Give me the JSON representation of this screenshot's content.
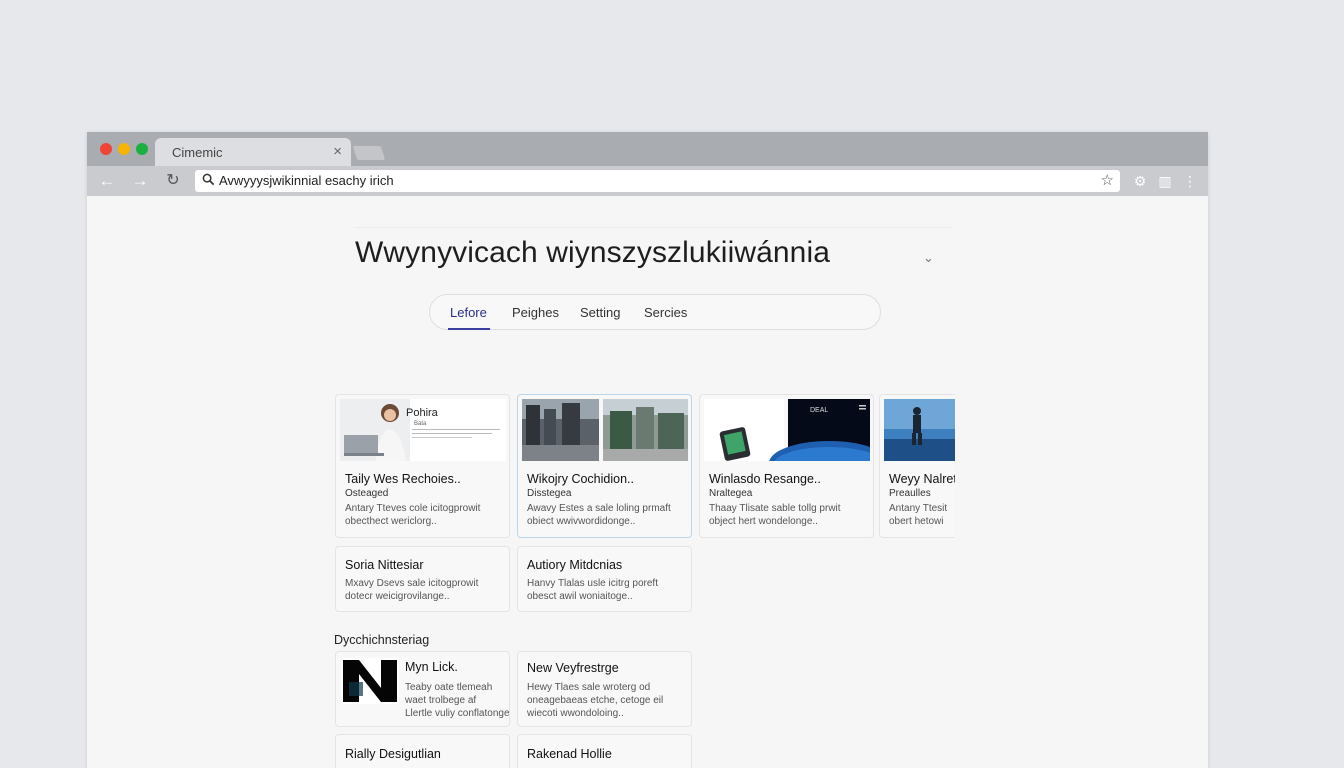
{
  "browser": {
    "tab_title": "Cimemic",
    "tab_close": "×",
    "url": "Avwyyysjwikinnial esachy irich"
  },
  "page": {
    "title": "Wwynyvicach wiynszyszlukiiwánnia",
    "tabs": [
      {
        "label": "Lefore",
        "active": true
      },
      {
        "label": "Peighes",
        "active": false
      },
      {
        "label": "Setting",
        "active": false
      },
      {
        "label": "Sercies",
        "active": false
      }
    ]
  },
  "cards_row1": [
    {
      "title": "Taily Wes Rechoies..",
      "subtitle": "Osteaged",
      "desc": "Antary Tteves cole icitogprowit\nobecthect wericlorg..",
      "thumb_caption": "Pohira",
      "thumb_caption_small": "Bata"
    },
    {
      "title": "Wikojry Cochidion..",
      "subtitle": "Disstegea",
      "desc": "Awavy Estes a sale loling prmaft\nobiect wwivwordidonge..",
      "selected": true
    },
    {
      "title": "Winlasdo Resange..",
      "subtitle": "Nraltegea",
      "desc": "Thaay Tlisate sable tollg prwit\nobject hert wondelonge..",
      "thumb_caption": "DEAL"
    },
    {
      "title": "Weyy Nalret",
      "subtitle": "Preaulles",
      "desc": "Antany Ttesit\nobert hetowi"
    }
  ],
  "cards_row2": [
    {
      "title": "Soria Nittesiar",
      "desc": "Mxavy Dsevs sale icitogprowit\ndotecr weicigrovilange.."
    },
    {
      "title": "Autiory Mitdcnias",
      "desc": "Hanvy Tlalas usle icitrg poreft\nobesct awil woniaitoge.."
    }
  ],
  "section_heading": "Dycchichnsteriag",
  "cards_row3": [
    {
      "title": "Myn Lick.",
      "desc": "Teaby oate tlemeah\nwaet trolbege af\nLlertle vuliy conflatonge.."
    },
    {
      "title": "New Veyfrestrge",
      "desc": "Hewy Tlaes sale wroterg od\noneagebaeas etche, cetoge eil\nwiecoti wwondoloing.."
    }
  ],
  "cards_row4": [
    {
      "title": "Rially Desigutlian"
    },
    {
      "title": "Rakenad Hollie"
    }
  ],
  "colors": {
    "accent": "#3a3fa0",
    "close": "#ef4436",
    "minimize": "#f4b400",
    "maximize": "#1bb140"
  }
}
